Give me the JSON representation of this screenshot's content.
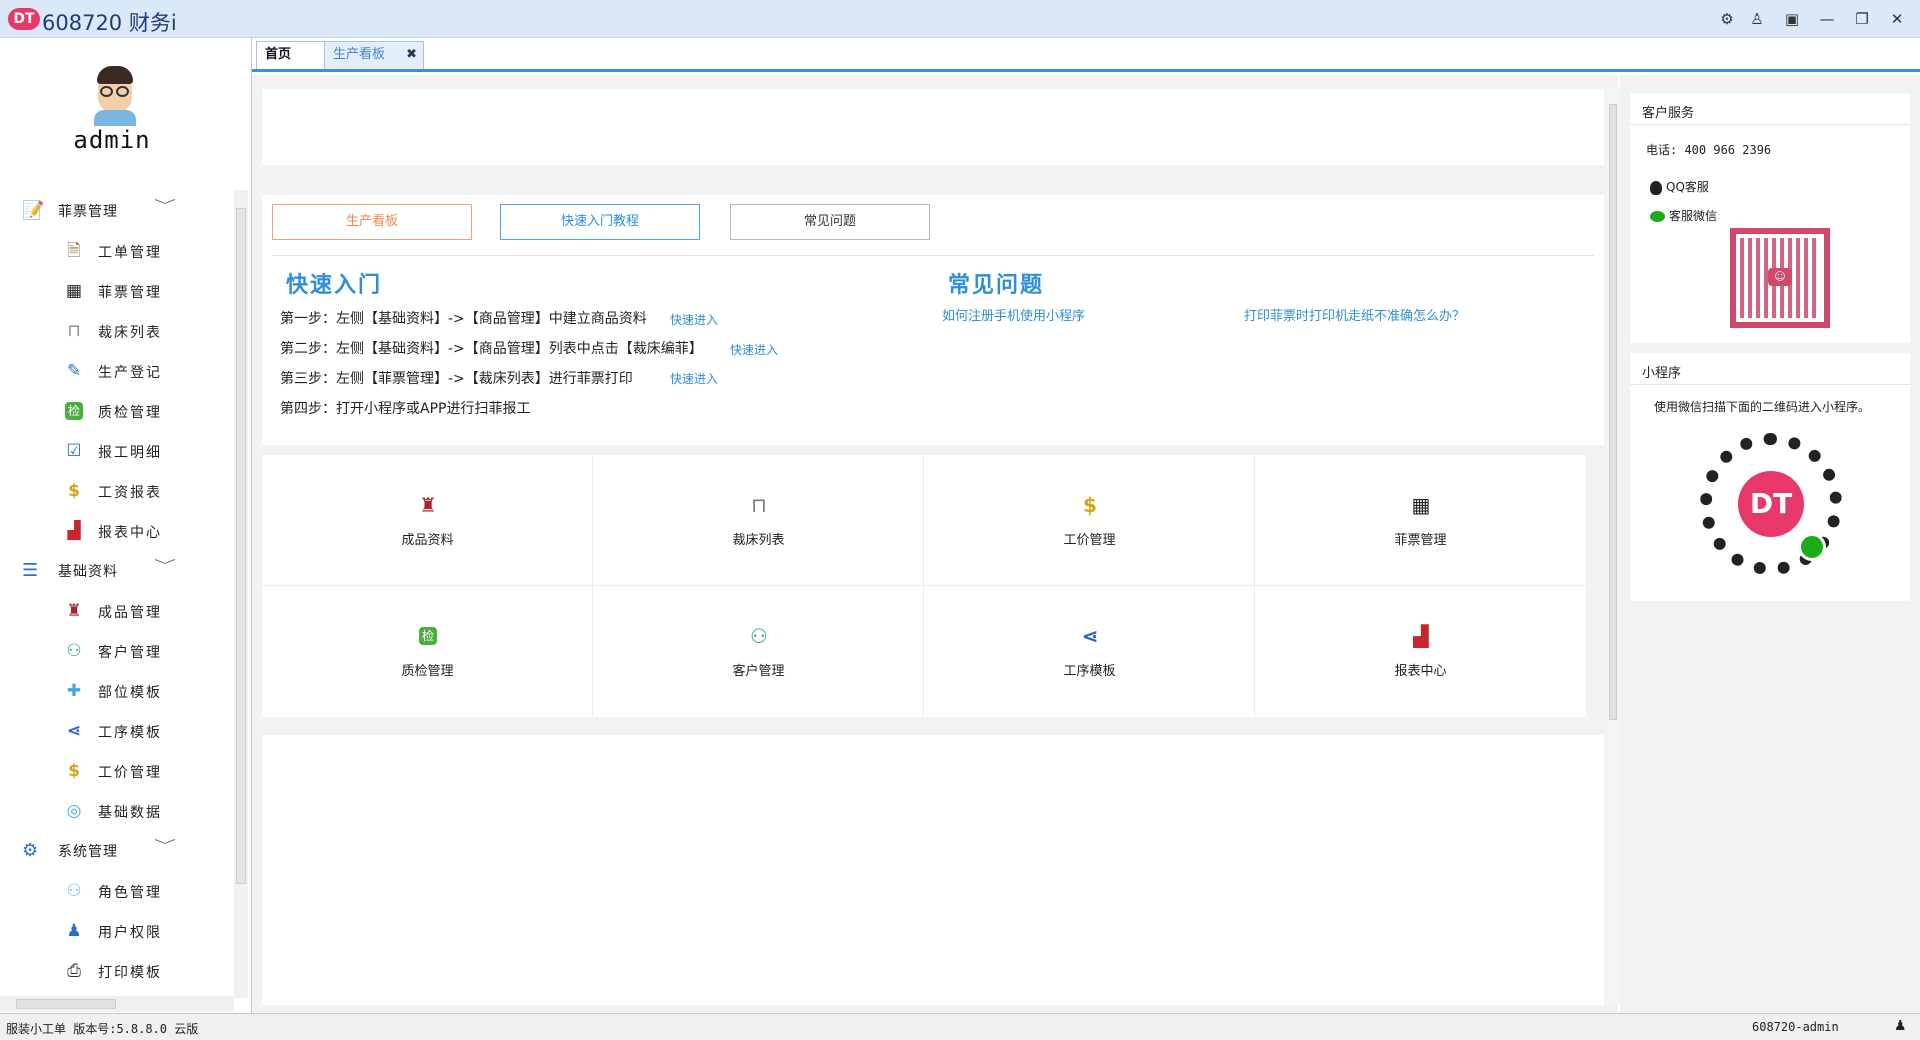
{
  "app": {
    "logo": "DT",
    "title": "608720 财务i"
  },
  "window_controls": [
    {
      "name": "gear-icon",
      "glyph": "⚙"
    },
    {
      "name": "user-icon",
      "glyph": "♙"
    },
    {
      "name": "switch-icon",
      "glyph": "▣"
    },
    {
      "name": "minimize-icon",
      "glyph": "—"
    },
    {
      "name": "restore-icon",
      "glyph": "❐"
    },
    {
      "name": "close-icon",
      "glyph": "✕"
    }
  ],
  "user": {
    "name": "admin"
  },
  "sidebar": {
    "groups": [
      {
        "label": "菲票管理",
        "icon": "notepad-icon",
        "items": [
          {
            "label": "工单管理",
            "icon": "work-order-icon",
            "glyph": "🗎"
          },
          {
            "label": "菲票管理",
            "icon": "qrcode-icon",
            "glyph": "▦"
          },
          {
            "label": "裁床列表",
            "icon": "cutting-table-icon",
            "glyph": "⊓"
          },
          {
            "label": "生产登记",
            "icon": "register-icon",
            "glyph": "✎"
          },
          {
            "label": "质检管理",
            "icon": "inspection-icon",
            "glyph": "检"
          },
          {
            "label": "报工明细",
            "icon": "checklist-icon",
            "glyph": "☑"
          },
          {
            "label": "工资报表",
            "icon": "salary-icon",
            "glyph": "$"
          },
          {
            "label": "报表中心",
            "icon": "chart-icon",
            "glyph": "▟"
          }
        ]
      },
      {
        "label": "基础资料",
        "icon": "list-icon",
        "items": [
          {
            "label": "成品管理",
            "icon": "garment-icon",
            "glyph": "♜"
          },
          {
            "label": "客户管理",
            "icon": "customers-icon",
            "glyph": "⚇"
          },
          {
            "label": "部位模板",
            "icon": "puzzle-icon",
            "glyph": "✚"
          },
          {
            "label": "工序模板",
            "icon": "share-icon",
            "glyph": "⋖"
          },
          {
            "label": "工价管理",
            "icon": "money-bag-icon",
            "glyph": "$"
          },
          {
            "label": "基础数据",
            "icon": "database-icon",
            "glyph": "◎"
          }
        ]
      },
      {
        "label": "系统管理",
        "icon": "gears-icon",
        "items": [
          {
            "label": "角色管理",
            "icon": "roles-icon",
            "glyph": "⚇"
          },
          {
            "label": "用户权限",
            "icon": "user-icon",
            "glyph": "♟"
          },
          {
            "label": "打印模板",
            "icon": "printer-icon",
            "glyph": "⎙"
          }
        ]
      }
    ]
  },
  "tabs": [
    {
      "label": "首页"
    },
    {
      "label": "生产看板",
      "close": "✖"
    }
  ],
  "main": {
    "buttons": [
      "生产看板",
      "快速入门教程",
      "常见问题"
    ],
    "quickstart": {
      "title": "快速入门",
      "steps": [
        "第一步：左侧【基础资料】->【商品管理】中建立商品资料",
        "第二步：左侧【基础资料】->【商品管理】列表中点击【裁床编菲】",
        "第三步：左侧【菲票管理】->【裁床列表】进行菲票打印",
        "第四步：打开小程序或APP进行扫菲报工"
      ],
      "link": "快速进入"
    },
    "faq": {
      "title": "常见问题",
      "items": [
        "如何注册手机使用小程序",
        "打印菲票时打印机走纸不准确怎么办？"
      ]
    },
    "shortcuts": [
      {
        "label": "成品资料",
        "icon": "garment-icon",
        "glyph": "♜",
        "color": "#a3282b"
      },
      {
        "label": "裁床列表",
        "icon": "cutting-table-icon",
        "glyph": "⊓",
        "color": "#777777"
      },
      {
        "label": "工价管理",
        "icon": "money-bag-icon",
        "glyph": "$",
        "color": "#d9a21b"
      },
      {
        "label": "菲票管理",
        "icon": "qrcode-icon",
        "glyph": "▦",
        "color": "#222222"
      },
      {
        "label": "质检管理",
        "icon": "inspection-icon",
        "glyph": "检",
        "color": "#4cae3f"
      },
      {
        "label": "客户管理",
        "icon": "customers-icon",
        "glyph": "⚇",
        "color": "#29a39b"
      },
      {
        "label": "工序模板",
        "icon": "share-icon",
        "glyph": "⋖",
        "color": "#2a62c8"
      },
      {
        "label": "报表中心",
        "icon": "chart-icon",
        "glyph": "▟",
        "color": "#c8262f"
      }
    ]
  },
  "right": {
    "service": {
      "title": "客户服务",
      "phone": "电话: 400 966 2396",
      "qq": "QQ客服",
      "wechat": "客服微信"
    },
    "miniprogram": {
      "title": "小程序",
      "desc": "使用微信扫描下面的二维码进入小程序。",
      "badge": "DT"
    }
  },
  "status": {
    "left": "服装小工单  版本号:5.8.8.0 云版",
    "right": "608720-admin"
  },
  "colors": {
    "accent": "#2e8fd6",
    "brand": "#e8386a",
    "orange": "#f08a50"
  }
}
